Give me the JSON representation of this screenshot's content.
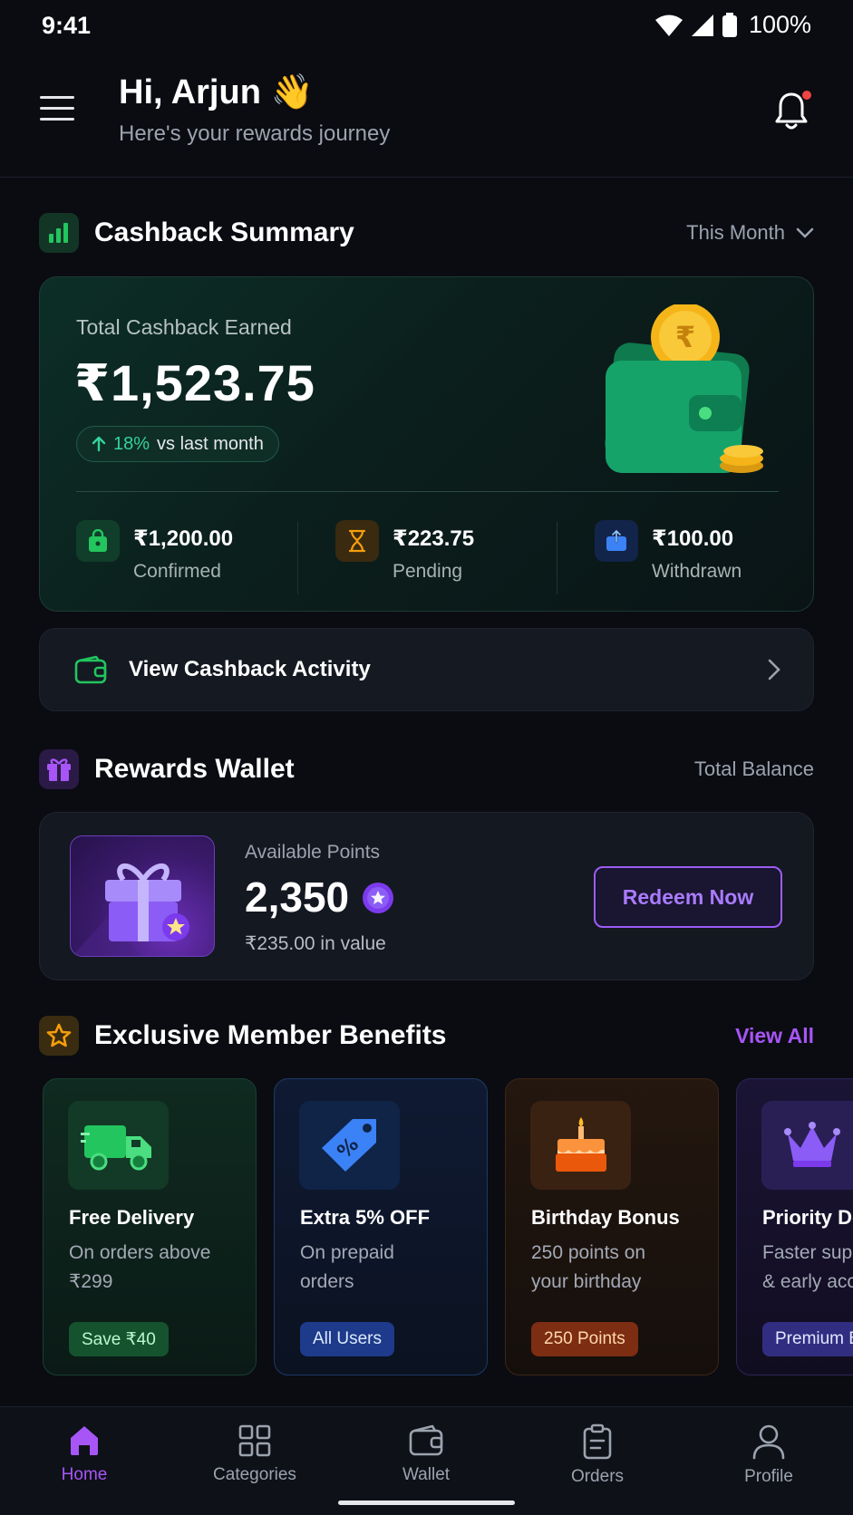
{
  "status_bar": {
    "time": "9:41",
    "battery": "100%"
  },
  "header": {
    "greeting": "Hi, Arjun 👋",
    "subtitle": "Here's your rewards journey"
  },
  "cashback": {
    "section_title": "Cashback Summary",
    "period": "This Month",
    "total_label": "Total Cashback Earned",
    "total_amount": "₹1,523.75",
    "change_pct": "18%",
    "change_text": "vs last month",
    "stats": [
      {
        "value": "₹1,200.00",
        "label": "Confirmed",
        "icon": "shopping-bag-icon",
        "color": "#22c55e"
      },
      {
        "value": "₹223.75",
        "label": "Pending",
        "icon": "hourglass-icon",
        "color": "#f59e0b"
      },
      {
        "value": "₹100.00",
        "label": "Withdrawn",
        "icon": "withdraw-icon",
        "color": "#3b82f6"
      }
    ]
  },
  "activity": {
    "label": "View Cashback Activity"
  },
  "rewards": {
    "section_title": "Rewards Wallet",
    "right_label": "Total Balance",
    "points_label": "Available Points",
    "points": "2,350",
    "value_text": "₹235.00 in value",
    "redeem_label": "Redeem Now"
  },
  "benefits": {
    "section_title": "Exclusive Member Benefits",
    "view_all": "View All",
    "items": [
      {
        "title": "Free Delivery",
        "desc": "On orders above\n₹299",
        "tag": "Save ₹40",
        "icon": "truck-icon",
        "accent": "#22c55e"
      },
      {
        "title": "Extra 5% OFF",
        "desc": "On prepaid\norders",
        "tag": "All Users",
        "icon": "discount-tag-icon",
        "accent": "#3b82f6"
      },
      {
        "title": "Birthday Bonus",
        "desc": "250 points on\nyour birthday",
        "tag": "250 Points",
        "icon": "cake-icon",
        "accent": "#f97316"
      },
      {
        "title": "Priority Delivery",
        "desc": "Faster support\n& early access",
        "tag": "Premium Benefit",
        "icon": "crown-icon",
        "accent": "#8b5cf6"
      }
    ]
  },
  "nav": {
    "items": [
      {
        "label": "Home",
        "icon": "home-icon",
        "active": true
      },
      {
        "label": "Categories",
        "icon": "grid-icon",
        "active": false
      },
      {
        "label": "Wallet",
        "icon": "wallet-icon",
        "active": false
      },
      {
        "label": "Orders",
        "icon": "clipboard-icon",
        "active": false
      },
      {
        "label": "Profile",
        "icon": "user-icon",
        "active": false
      }
    ]
  },
  "colors": {
    "accent": "#a855f7",
    "success": "#34d399",
    "background": "#0a0c12"
  }
}
